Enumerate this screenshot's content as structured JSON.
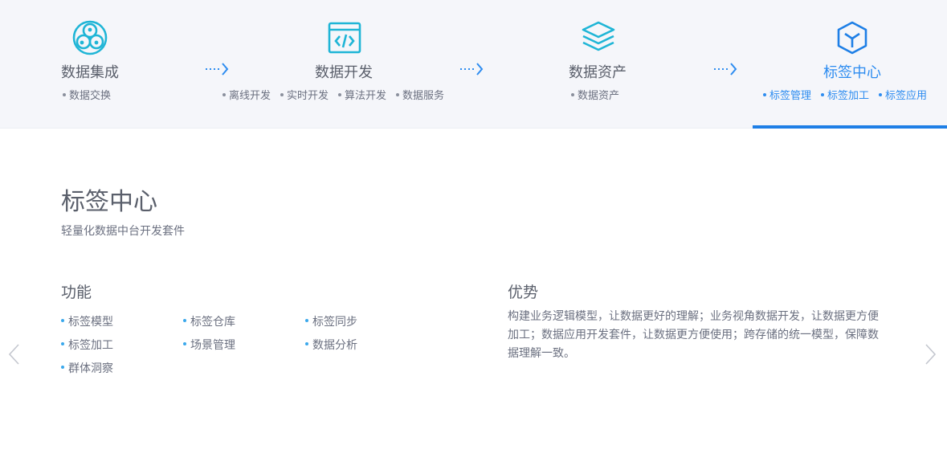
{
  "steps": [
    {
      "title": "数据集成",
      "icon": "network-circles-icon",
      "subs": [
        "数据交换"
      ]
    },
    {
      "title": "数据开发",
      "icon": "code-window-icon",
      "subs": [
        "离线开发",
        "实时开发",
        "算法开发",
        "数据服务"
      ]
    },
    {
      "title": "数据资产",
      "icon": "layers-stack-icon",
      "subs": [
        "数据资产"
      ]
    },
    {
      "title": "标签中心",
      "icon": "cube-icon",
      "subs": [
        "标签管理",
        "标签加工",
        "标签应用"
      ]
    }
  ],
  "active_step": 3,
  "colors": {
    "active": "#2d8cf0",
    "icon": "#1fb5d6",
    "active_icon": "#1e7fe6",
    "bullet": "#3aa8ec"
  },
  "main": {
    "title": "标签中心",
    "subtitle": "轻量化数据中台开发套件"
  },
  "features": {
    "title": "功能",
    "items": [
      "标签模型",
      "标签仓库",
      "标签同步",
      "标签加工",
      "场景管理",
      "数据分析",
      "群体洞察"
    ]
  },
  "advantages": {
    "title": "优势",
    "text": "构建业务逻辑模型，让数据更好的理解；业务视角数据开发，让数据更方便加工；数据应用开发套件，让数据更方便使用；跨存储的统一模型，保障数据理解一致。"
  },
  "nav": {
    "prev": "chevron-left-icon",
    "next": "chevron-right-icon"
  }
}
